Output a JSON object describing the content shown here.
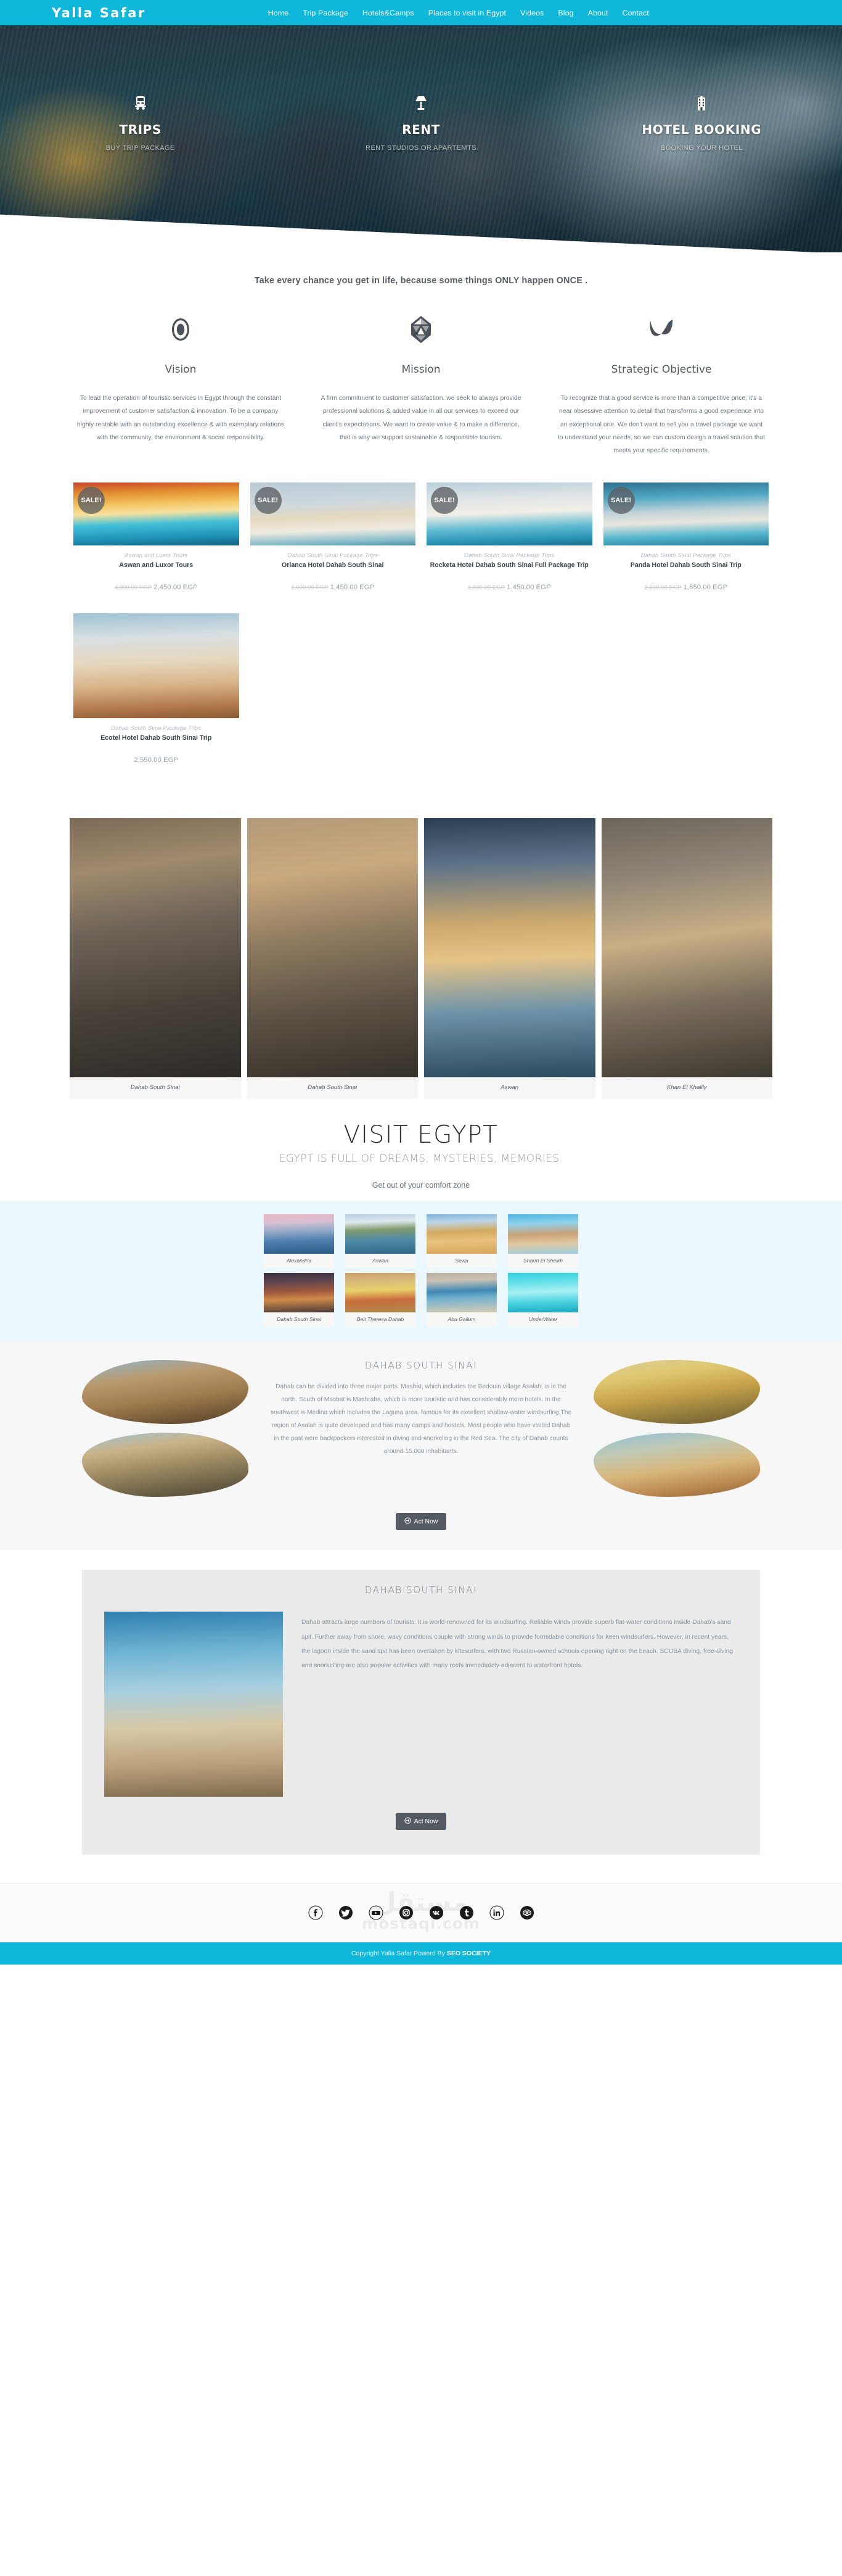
{
  "brand": "Yalla Safar",
  "nav": [
    {
      "label": "Home"
    },
    {
      "label": "Trip Package"
    },
    {
      "label": "Hotels&Camps"
    },
    {
      "label": "Places to visit in Egypt"
    },
    {
      "label": "Videos"
    },
    {
      "label": "Blog"
    },
    {
      "label": "About"
    },
    {
      "label": "Contact"
    }
  ],
  "hero": {
    "features": [
      {
        "icon": "bus-icon",
        "title": "TRIPS",
        "subtitle": "BUY TRIP PACKAGE"
      },
      {
        "icon": "lamp-icon",
        "title": "RENT",
        "subtitle": "RENT STUDIOS OR APARTEMTS"
      },
      {
        "icon": "hotel-building-icon",
        "title": "HOTEL BOOKING",
        "subtitle": "BOOKING YOUR HOTEL"
      }
    ]
  },
  "tagline": "Take every chance you get in life, because some things ONLY happen ONCE .",
  "vms": [
    {
      "icon": "eye-icon",
      "title": "Vision",
      "body": "To lead the operation of touristic services in Egypt through the constant improvement of customer satisfaction & innovation. To be a company highly rentable with an outstanding excellence & with exemplary relations with the community, the environment & social responsibility."
    },
    {
      "icon": "gem-icon",
      "title": "Mission",
      "body": "A firm commitment to customer satisfaction. we seek to always provide professional solutions & added value in all our services to exceed our client's expectations. We want to create value & to make a difference, that is why we support sustainable & responsible tourism."
    },
    {
      "icon": "wave-icon",
      "title": "Strategic Objective",
      "body": "To recognize that a good service is more than a competitive price; it's a near obsessive attention to detail that transforms a good experience into an exceptional one. We don't want to sell you a travel package we want to understand your needs, so we can custom design a travel solution that meets your specific requirements."
    }
  ],
  "products": [
    {
      "badge": "SALE!",
      "image": "img-nile",
      "category": "Aswan and Luxor Tours",
      "name": "Aswan and Luxor Tours",
      "old_price": "4,000.00 EGP",
      "price": "2,450.00 EGP"
    },
    {
      "badge": "SALE!",
      "image": "img-orianca",
      "category": "Dahab South Sinai Package Trips",
      "name": "Orianca Hotel Dahab South Sinai",
      "old_price": "1,600.00 EGP",
      "price": "1,450.00 EGP"
    },
    {
      "badge": "SALE!",
      "image": "img-rocketa",
      "category": "Dahab South Sinai Package Trips",
      "name": "Rocketa Hotel Dahab South Sinai Full Package Trip",
      "old_price": "1,600.00 EGP",
      "price": "1,450.00 EGP"
    },
    {
      "badge": "SALE!",
      "image": "img-panda",
      "category": "Dahab South Sinai Package Trips",
      "name": "Panda Hotel Dahab South Sinai Trip",
      "old_price": "2,200.00 EGP",
      "price": "1,650.00 EGP"
    },
    {
      "badge": "",
      "image": "img-ecotel",
      "category": "Dahab South Sinai Package Trips",
      "name": "Ecotel Hotel Dahab South Sinai Trip",
      "old_price": "",
      "price": "2,550.00 EGP"
    }
  ],
  "gallery": [
    {
      "image": "img-camp1",
      "caption": "Dahab South Sinai"
    },
    {
      "image": "img-camp2",
      "caption": "Dahab South Sinai"
    },
    {
      "image": "img-felucca",
      "caption": "Aswan"
    },
    {
      "image": "img-khan",
      "caption": "Khan El Khalily"
    }
  ],
  "visit": {
    "title": "VISIT EGYPT",
    "subtitle": "EGYPT IS FULL OF DREAMS, MYSTERIES, MEMORIES.",
    "subtitle2": "Get out of your comfort zone"
  },
  "destinations": [
    {
      "image": "img-alex",
      "caption": "Alexandria"
    },
    {
      "image": "img-aswan2",
      "caption": "Aswan"
    },
    {
      "image": "img-sewa",
      "caption": "Sewa"
    },
    {
      "image": "img-sharm",
      "caption": "Sharm El Sheikh"
    },
    {
      "image": "img-dahab",
      "caption": "Dahab South Sinai"
    },
    {
      "image": "img-beit",
      "caption": "Beit Theresa Dahab"
    },
    {
      "image": "img-abu",
      "caption": "Abu Gallum"
    },
    {
      "image": "img-under",
      "caption": "UnderWater"
    }
  ],
  "dahab_split": {
    "title": "DAHAB SOUTH SINAI",
    "body": "Dahab can be divided into three major parts. Masbat, which includes the Bedouin village Asalah, is in the north. South of Masbat is Mashraba, which is more touristic and has considerably more hotels. In the southwest is Medina which includes the Laguna area, famous for its excellent shallow-water windsurfing.The region of Asalah is quite developed and has many camps and hostels. Most people who have visited Dahab in the past were backpackers interested in diving and snorkeling in the Red Sea. The city of Dahab counts around 15,000 inhabitants.",
    "button": "Act Now",
    "left_images": [
      "img-blob1",
      "img-blob2"
    ],
    "right_images": [
      "img-blob3",
      "img-blob4"
    ]
  },
  "dahab_block2": {
    "title": "DAHAB SOUTH SINAI",
    "image": "img-swing",
    "body": "Dahab attracts large numbers of tourists. It is world-renowned for its windsurfing. Reliable winds provide superb flat-water conditions inside Dahab's sand spit. Further away from shore, wavy conditions couple with strong winds to provide formidable conditions for keen windsurfers. However, in recent years, the lagoon inside the sand spit has been overtaken by kitesurfers, with two Russian-owned schools opening right on the beach. SCUBA diving, free-diving and snorkelling are also popular activities with many reefs immediately adjacent to waterfront hotels.",
    "button": "Act Now"
  },
  "footer": {
    "watermark_line1": "مستقل",
    "watermark_line2": "mostaql.com",
    "socials": [
      {
        "name": "facebook-icon",
        "glyph": "f"
      },
      {
        "name": "twitter-icon",
        "glyph": "t"
      },
      {
        "name": "youtube-icon",
        "glyph": "y"
      },
      {
        "name": "instagram-icon",
        "glyph": "i"
      },
      {
        "name": "vk-icon",
        "glyph": "v"
      },
      {
        "name": "tumblr-icon",
        "glyph": "b"
      },
      {
        "name": "linkedin-icon",
        "glyph": "in"
      },
      {
        "name": "tripadvisor-icon",
        "glyph": "ta"
      }
    ],
    "copyright_prefix": "Copyright Yalla Safar Powerd By ",
    "copyright_brand": "SEO SOCIETY"
  },
  "colors": {
    "brand": "#0fb8da",
    "dark_button": "#555b62",
    "destinations_bg": "#eaf7fc"
  }
}
